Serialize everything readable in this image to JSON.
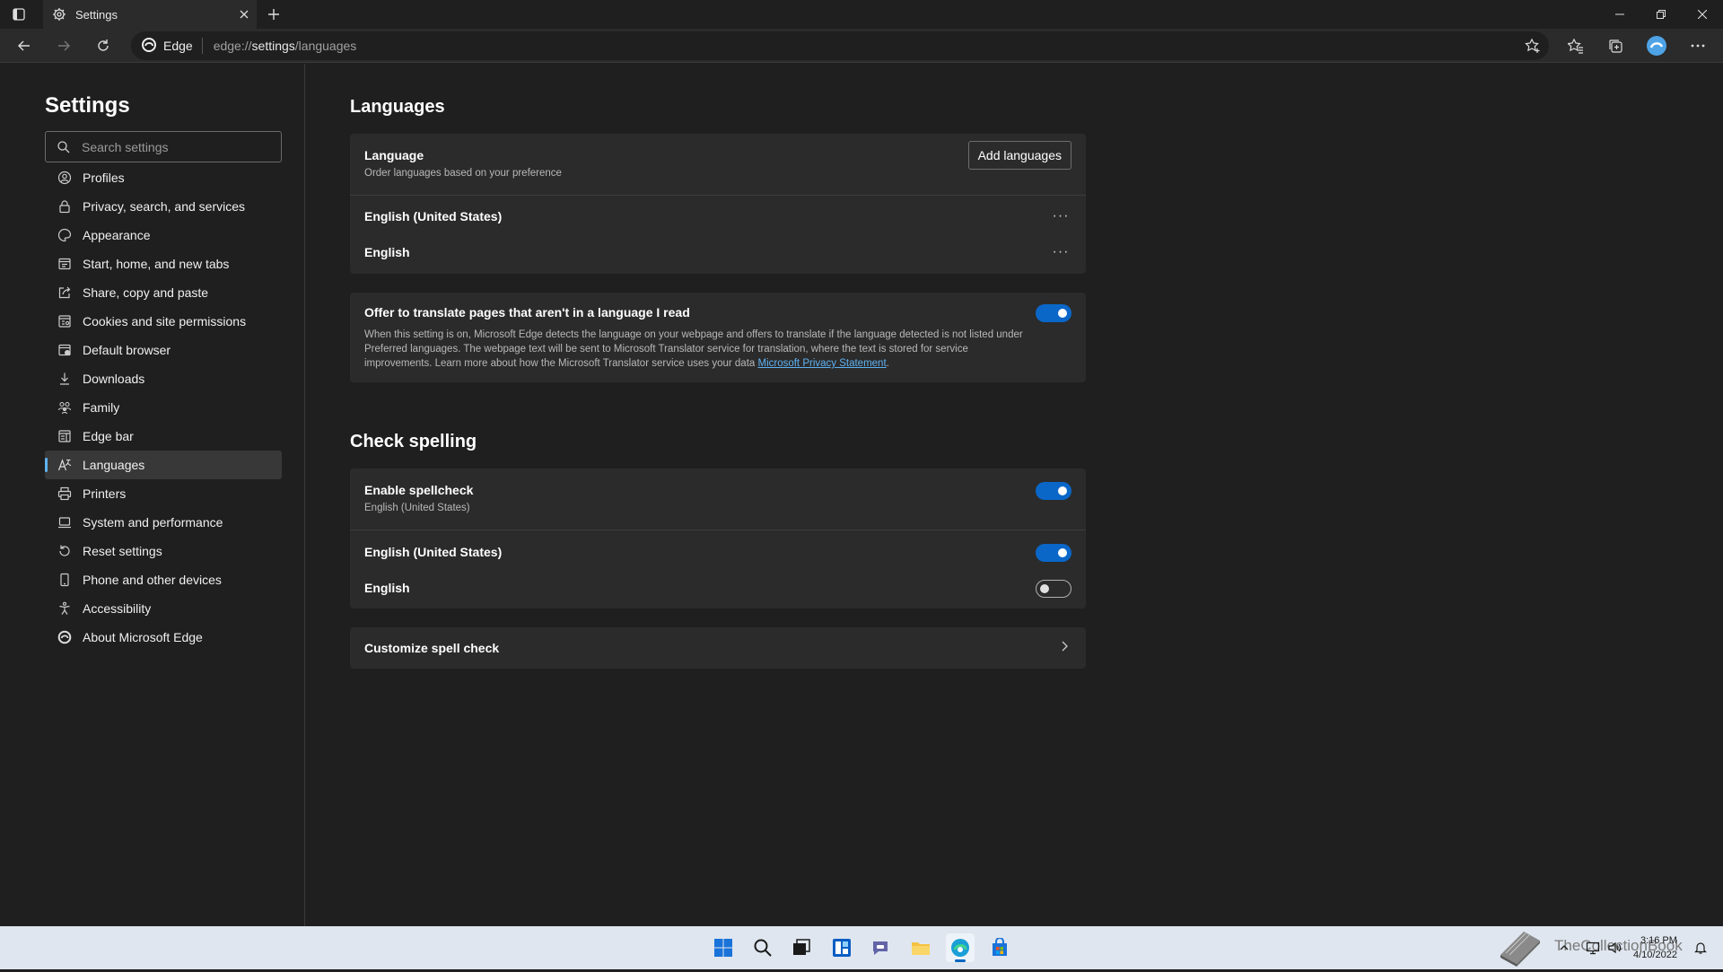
{
  "window": {
    "tab_title": "Settings"
  },
  "toolbar": {
    "site_label": "Edge",
    "url_prefix": "edge://",
    "url_host": "settings",
    "url_path": "/languages"
  },
  "sidebar": {
    "title": "Settings",
    "search_placeholder": "Search settings",
    "items": [
      {
        "label": "Profiles",
        "icon": "profile-icon"
      },
      {
        "label": "Privacy, search, and services",
        "icon": "lock-icon"
      },
      {
        "label": "Appearance",
        "icon": "appearance-icon"
      },
      {
        "label": "Start, home, and new tabs",
        "icon": "home-icon"
      },
      {
        "label": "Share, copy and paste",
        "icon": "share-icon"
      },
      {
        "label": "Cookies and site permissions",
        "icon": "cookies-icon"
      },
      {
        "label": "Default browser",
        "icon": "browser-icon"
      },
      {
        "label": "Downloads",
        "icon": "download-icon"
      },
      {
        "label": "Family",
        "icon": "family-icon"
      },
      {
        "label": "Edge bar",
        "icon": "edgebar-icon"
      },
      {
        "label": "Languages",
        "icon": "languages-icon",
        "active": true
      },
      {
        "label": "Printers",
        "icon": "printer-icon"
      },
      {
        "label": "System and performance",
        "icon": "laptop-icon"
      },
      {
        "label": "Reset settings",
        "icon": "reset-icon"
      },
      {
        "label": "Phone and other devices",
        "icon": "phone-icon"
      },
      {
        "label": "Accessibility",
        "icon": "accessibility-icon"
      },
      {
        "label": "About Microsoft Edge",
        "icon": "edge-logo-icon"
      }
    ]
  },
  "languages": {
    "heading": "Languages",
    "language_title": "Language",
    "language_sub": "Order languages based on your preference",
    "add_button": "Add languages",
    "list": [
      "English (United States)",
      "English"
    ],
    "more_glyph": "···"
  },
  "translate": {
    "title": "Offer to translate pages that aren't in a language I read",
    "description": "When this setting is on, Microsoft Edge detects the language on your webpage and offers to translate if the language detected is not listed under Preferred languages. The webpage text will be sent to Microsoft Translator service for translation, where the text is stored for service improvements. Learn more about how the Microsoft Translator service uses your data ",
    "link": "Microsoft Privacy Statement",
    "link_suffix": ".",
    "enabled": true
  },
  "spelling": {
    "heading": "Check spelling",
    "enable_title": "Enable spellcheck",
    "enable_sub": "English (United States)",
    "enable_on": true,
    "languages": [
      {
        "label": "English (United States)",
        "on": true
      },
      {
        "label": "English",
        "on": false
      }
    ],
    "customize": "Customize spell check"
  },
  "taskbar": {
    "time": "3:16 PM",
    "date": "4/10/2022",
    "watermark": "TheCollectionBook"
  },
  "colors": {
    "accent": "#0a67c8",
    "link": "#5fb2f2",
    "card": "#2b2b2b",
    "background": "#1f1f1f"
  }
}
